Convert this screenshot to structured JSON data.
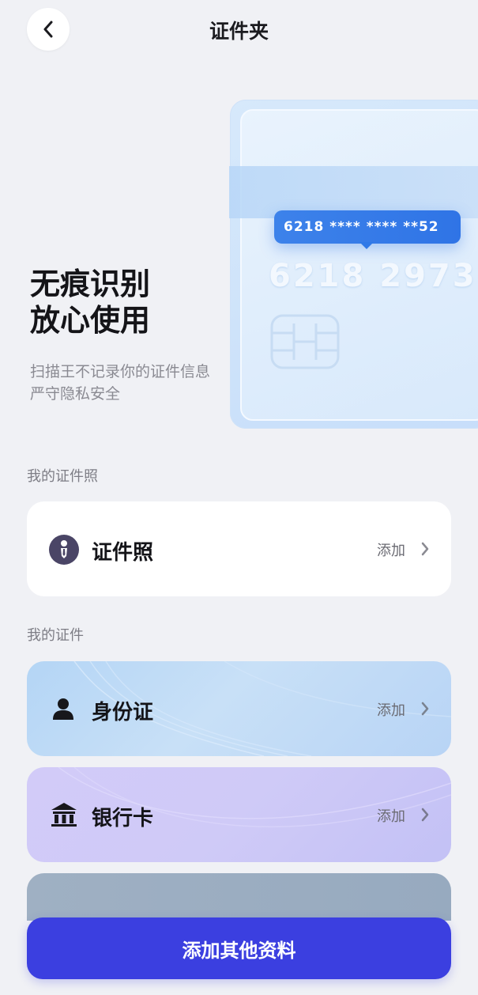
{
  "header": {
    "title": "证件夹",
    "back_icon": "chevron-left-icon"
  },
  "hero": {
    "headline_line1": "无痕识别",
    "headline_line2": "放心使用",
    "subtitle_line1": "扫描王不记录你的证件信息",
    "subtitle_line2": "严守隐私安全",
    "card_masked_number": "6218 **** **** **52",
    "card_number_partial": "6218 2973"
  },
  "sections": {
    "photos_label": "我的证件照",
    "documents_label": "我的证件"
  },
  "rows": {
    "photo": {
      "label": "证件照",
      "action": "添加",
      "icon": "id-photo-icon"
    },
    "id_card": {
      "label": "身份证",
      "action": "添加",
      "icon": "person-icon"
    },
    "bank_card": {
      "label": "银行卡",
      "action": "添加",
      "icon": "bank-icon"
    }
  },
  "bottom": {
    "button_label": "添加其他资料"
  },
  "colors": {
    "background": "#f0f1f5",
    "accent": "#3b3fe0",
    "card_tag": "#3079e7",
    "id_row": "#b4d5f5",
    "bank_row": "#cfcaf7"
  }
}
